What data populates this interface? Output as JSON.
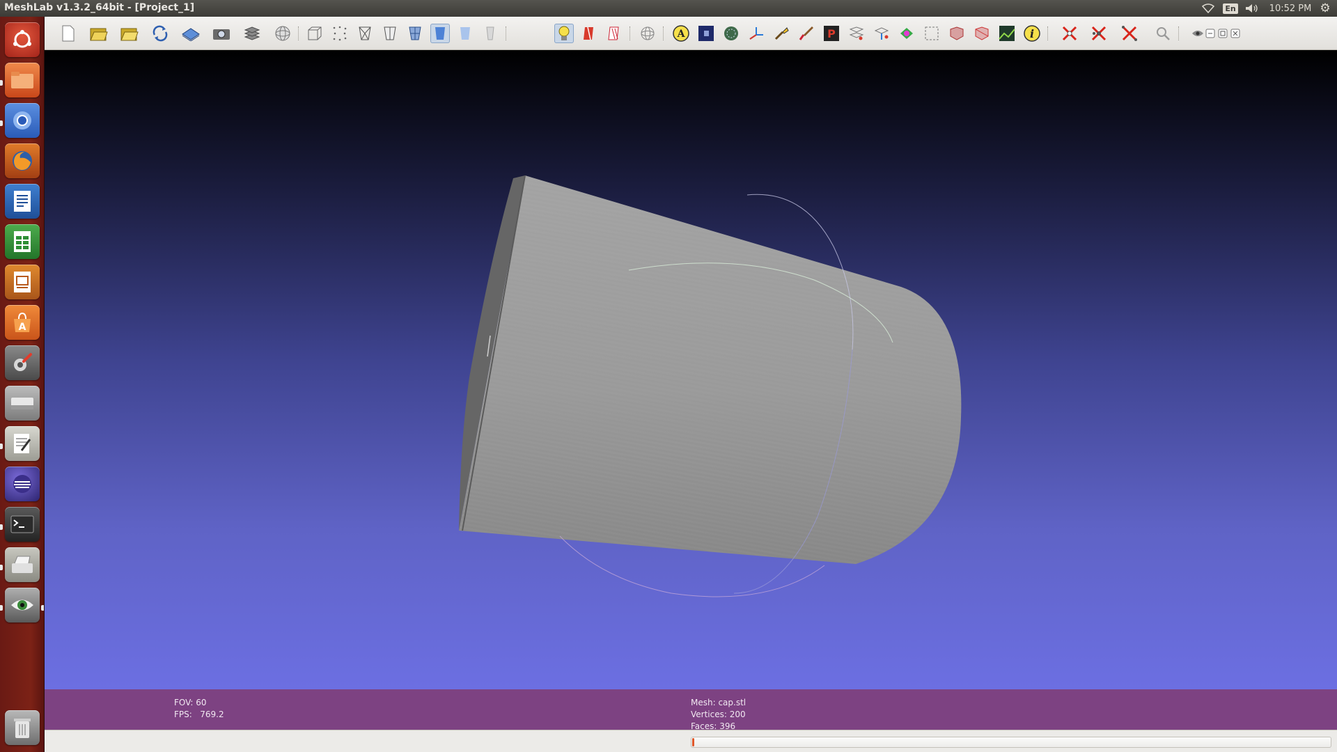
{
  "window": {
    "title": "MeshLab v1.3.2_64bit - [Project_1]"
  },
  "tray": {
    "language": "En",
    "clock": "10:52 PM"
  },
  "launcher": {
    "items": [
      "dash-home",
      "files",
      "chromium-browser",
      "firefox-browser",
      "libreoffice-writer",
      "libreoffice-calc",
      "libreoffice-impress",
      "software-center",
      "system-settings",
      "removable-drive",
      "text-editor",
      "eclipse-ide",
      "terminal",
      "scanner",
      "eye-of-gnome"
    ],
    "trash": "trash"
  },
  "toolbar": {
    "buttons": [
      "new-file",
      "open-project",
      "open-file",
      "reload",
      "save-snapshot-plane",
      "snapshot-camera",
      "layers",
      "wireframe-sphere",
      "bounding-box",
      "points",
      "wireframe",
      "hidden-lines",
      "flat-lines",
      "flat-shading",
      "smooth-shading",
      "texture",
      "lighting",
      "double-side-lighting",
      "back-face-culling",
      "trackball",
      "annotate",
      "raster",
      "color",
      "axis",
      "measure",
      "paint",
      "pick-points",
      "align",
      "edit-ref",
      "manipulate",
      "select-vertices",
      "select-faces",
      "select-connected",
      "select-region",
      "render-shader",
      "info",
      "delete-faces",
      "delete-vertices",
      "delete-selection",
      "zoom",
      "eye",
      "minimize",
      "restore",
      "close"
    ]
  },
  "info": {
    "fov": "FOV: 60",
    "fps": "FPS:   769.2",
    "mesh": "Mesh: cap.stl",
    "vertices": "Vertices: 200",
    "faces": "Faces: 396"
  },
  "colors": {
    "mesh": "#9a9a9a",
    "info_bar": "#7d4282",
    "progress": "#e0582a",
    "launcher": "#7c2216"
  },
  "progress": {
    "value": 0.003
  }
}
